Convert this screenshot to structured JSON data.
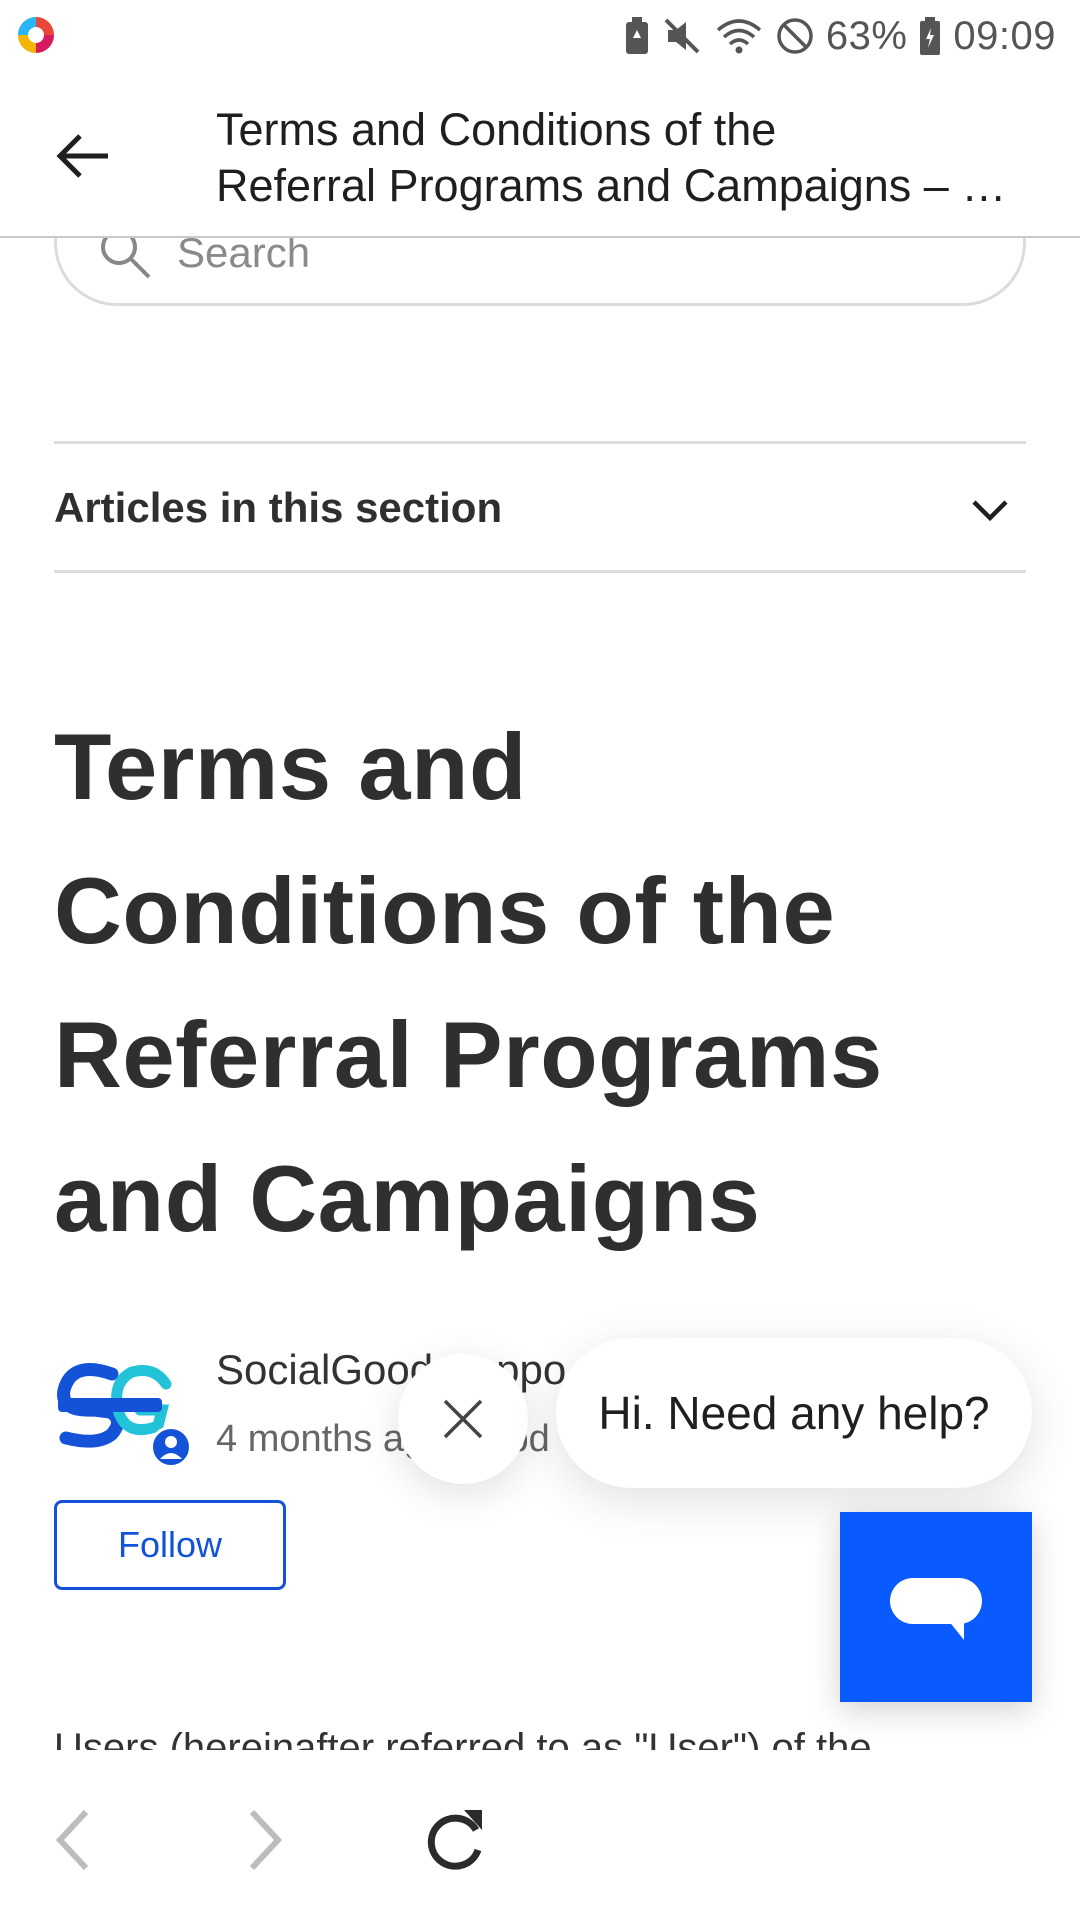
{
  "status_bar": {
    "battery_percent": "63%",
    "time": "09:09",
    "icons": [
      "app-logo-icon",
      "battery-saver-icon",
      "mute-icon",
      "wifi-icon",
      "do-not-disturb-icon",
      "battery-icon"
    ]
  },
  "toolbar": {
    "title_line1": "Terms and Conditions of the",
    "title_line2": "Referral Programs and Campaigns – …"
  },
  "search": {
    "placeholder": "Search"
  },
  "section": {
    "label": "Articles in this section"
  },
  "article": {
    "title": "Terms and Conditions of the Referral Programs and Campaigns",
    "author_name": "SocialGood Suppo",
    "meta": "4 months ago · Upd",
    "follow_label": "Follow",
    "body_preview": "Users (hereinafter referred to as \"User\") of the"
  },
  "chat": {
    "greeting": "Hi. Need any help?"
  },
  "colors": {
    "accent": "#1452d8",
    "chat_blue": "#0a5bff",
    "text": "#2f2f2f"
  }
}
